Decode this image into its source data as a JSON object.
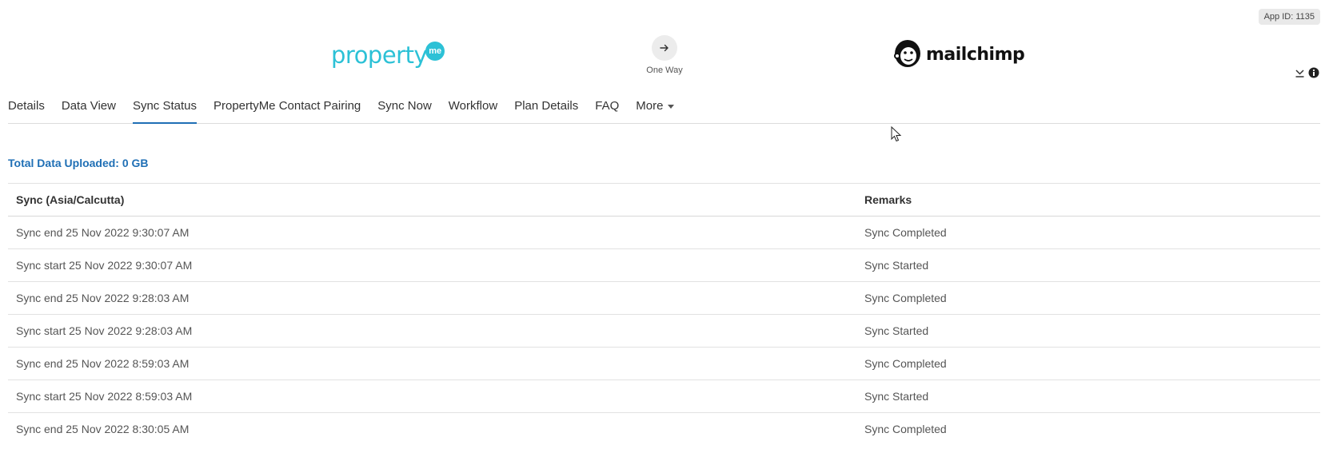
{
  "app_id": "App ID: 1135",
  "header": {
    "left_logo_word": "property",
    "left_logo_badge": "me",
    "direction_label": "One Way",
    "right_logo_word": "mailchimp"
  },
  "tabs": [
    {
      "label": "Details"
    },
    {
      "label": "Data View"
    },
    {
      "label": "Sync Status"
    },
    {
      "label": "PropertyMe Contact Pairing"
    },
    {
      "label": "Sync Now"
    },
    {
      "label": "Workflow"
    },
    {
      "label": "Plan Details"
    },
    {
      "label": "FAQ"
    },
    {
      "label": "More"
    }
  ],
  "active_tab": "Sync Status",
  "total_uploaded": "Total Data Uploaded: 0 GB",
  "table": {
    "headers": [
      "Sync (Asia/Calcutta)",
      "Remarks"
    ],
    "rows": [
      [
        "Sync end 25 Nov 2022 9:30:07 AM",
        "Sync Completed"
      ],
      [
        "Sync start 25 Nov 2022 9:30:07 AM",
        "Sync Started"
      ],
      [
        "Sync end 25 Nov 2022 9:28:03 AM",
        "Sync Completed"
      ],
      [
        "Sync start 25 Nov 2022 9:28:03 AM",
        "Sync Started"
      ],
      [
        "Sync end 25 Nov 2022 8:59:03 AM",
        "Sync Completed"
      ],
      [
        "Sync start 25 Nov 2022 8:59:03 AM",
        "Sync Started"
      ],
      [
        "Sync end 25 Nov 2022 8:30:05 AM",
        "Sync Completed"
      ]
    ]
  },
  "colors": {
    "accent": "#1f6fb5",
    "propertyme": "#2cc1d6"
  }
}
